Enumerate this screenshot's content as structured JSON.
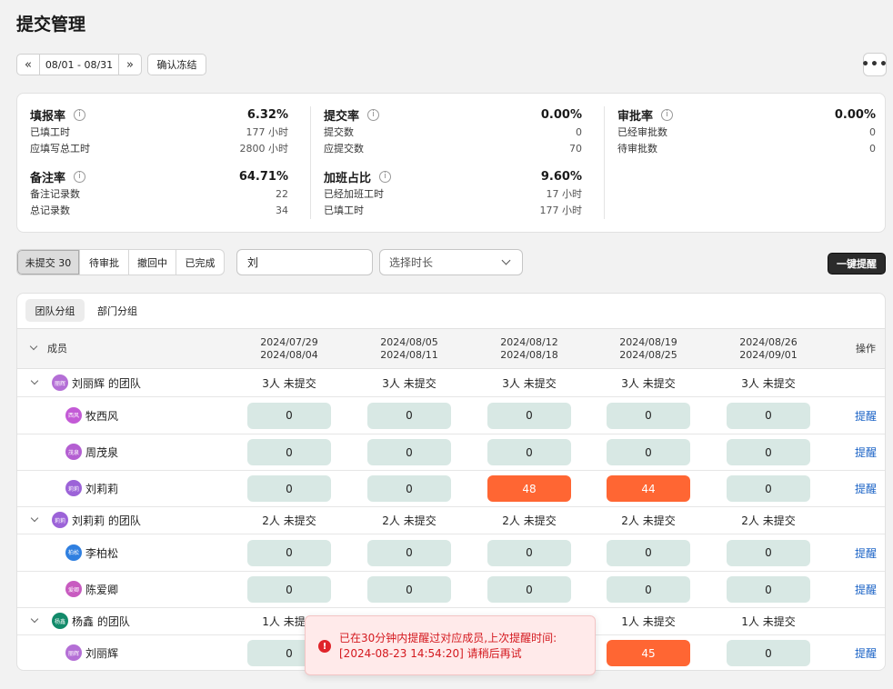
{
  "page_title": "提交管理",
  "toolbar": {
    "prev": "«",
    "date_range": "08/01 - 08/31",
    "next": "»",
    "confirm_freeze": "确认冻结",
    "more": "•••"
  },
  "stats": [
    {
      "title": "填报率",
      "value": "6.32%",
      "rows": [
        {
          "label": "已填工时",
          "value": "177 小时"
        },
        {
          "label": "应填写总工时",
          "value": "2800 小时"
        }
      ]
    },
    {
      "title": "提交率",
      "value": "0.00%",
      "rows": [
        {
          "label": "提交数",
          "value": "0"
        },
        {
          "label": "应提交数",
          "value": "70"
        }
      ]
    },
    {
      "title": "审批率",
      "value": "0.00%",
      "rows": [
        {
          "label": "已经审批数",
          "value": "0"
        },
        {
          "label": "待审批数",
          "value": "0"
        }
      ]
    },
    {
      "title": "备注率",
      "value": "64.71%",
      "rows": [
        {
          "label": "备注记录数",
          "value": "22"
        },
        {
          "label": "总记录数",
          "value": "34"
        }
      ]
    },
    {
      "title": "加班占比",
      "value": "9.60%",
      "rows": [
        {
          "label": "已经加班工时",
          "value": "17 小时"
        },
        {
          "label": "已填工时",
          "value": "177 小时"
        }
      ]
    }
  ],
  "status_tabs": [
    "未提交 30",
    "待审批",
    "撤回中",
    "已完成"
  ],
  "search": {
    "value": "刘"
  },
  "duration_select": {
    "placeholder": "选择时长"
  },
  "remind_all": "一键提醒",
  "group_tabs": [
    "团队分组",
    "部门分组"
  ],
  "table": {
    "member_header": "成员",
    "action_header": "操作",
    "weeks": [
      {
        "start": "2024/07/29",
        "end": "2024/08/04"
      },
      {
        "start": "2024/08/05",
        "end": "2024/08/11"
      },
      {
        "start": "2024/08/12",
        "end": "2024/08/18"
      },
      {
        "start": "2024/08/19",
        "end": "2024/08/25"
      },
      {
        "start": "2024/08/26",
        "end": "2024/09/01"
      }
    ],
    "rows": [
      {
        "kind": "team",
        "name": "刘丽辉 的团队",
        "avatar": "丽辉",
        "avatar_color": "#b46fd6",
        "summary": [
          "3人 未提交",
          "3人 未提交",
          "3人 未提交",
          "3人 未提交",
          "3人 未提交"
        ]
      },
      {
        "kind": "member",
        "name": "牧西风",
        "avatar": "西风",
        "avatar_color": "#c35ad6",
        "values": [
          "0",
          "0",
          "0",
          "0",
          "0"
        ],
        "action": "提醒"
      },
      {
        "kind": "member",
        "name": "周茂泉",
        "avatar": "茂泉",
        "avatar_color": "#b45fd2",
        "values": [
          "0",
          "0",
          "0",
          "0",
          "0"
        ],
        "action": "提醒"
      },
      {
        "kind": "member",
        "name": "刘莉莉",
        "avatar": "莉莉",
        "avatar_color": "#9c63d8",
        "values": [
          "0",
          "0",
          "48",
          "44",
          "0"
        ],
        "hot": [
          false,
          false,
          true,
          true,
          false
        ],
        "action": "提醒"
      },
      {
        "kind": "team",
        "name": "刘莉莉 的团队",
        "avatar": "莉莉",
        "avatar_color": "#9c63d8",
        "summary": [
          "2人 未提交",
          "2人 未提交",
          "2人 未提交",
          "2人 未提交",
          "2人 未提交"
        ]
      },
      {
        "kind": "member",
        "name": "李柏松",
        "avatar": "柏松",
        "avatar_color": "#2f7fe0",
        "values": [
          "0",
          "0",
          "0",
          "0",
          "0"
        ],
        "action": "提醒"
      },
      {
        "kind": "member",
        "name": "陈爱卿",
        "avatar": "爱卿",
        "avatar_color": "#c85bc0",
        "values": [
          "0",
          "0",
          "0",
          "0",
          "0"
        ],
        "action": "提醒"
      },
      {
        "kind": "team",
        "name": "杨鑫 的团队",
        "avatar": "杨鑫",
        "avatar_color": "#128a6a",
        "summary": [
          "1人 未提交",
          "",
          "",
          "1人 未提交",
          "1人 未提交"
        ]
      },
      {
        "kind": "member",
        "name": "刘丽辉",
        "avatar": "丽辉",
        "avatar_color": "#b46fd6",
        "values": [
          "0",
          "",
          "",
          "45",
          "0"
        ],
        "hot": [
          false,
          false,
          false,
          true,
          false
        ],
        "action": "提醒"
      }
    ]
  },
  "toast": {
    "icon": "error-icon",
    "message": "已在30分钟内提醒过对应成员,上次提醒时间: [2024-08-23 14:54:20] 请稍后再试"
  }
}
